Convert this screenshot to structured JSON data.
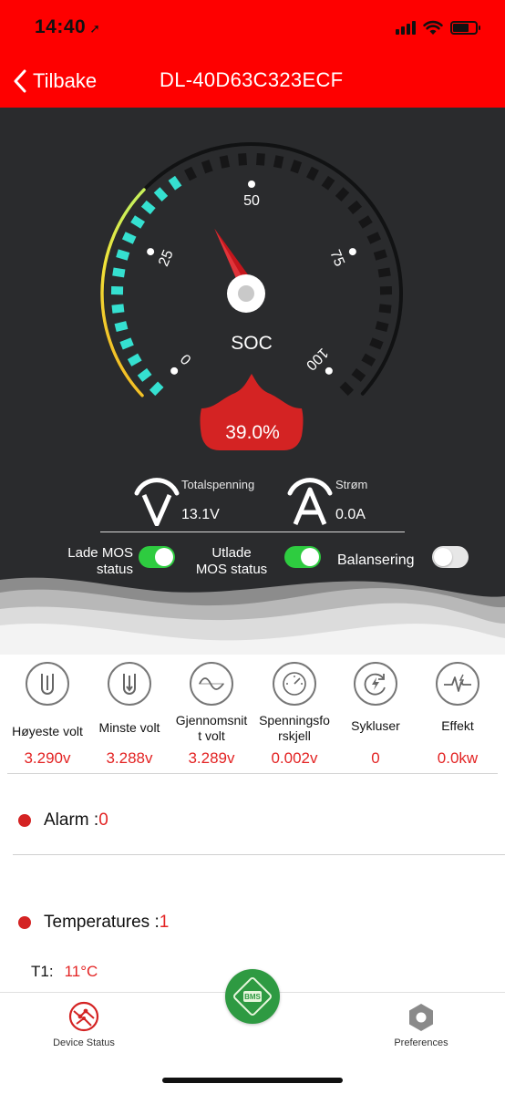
{
  "status_bar": {
    "time": "14:40",
    "location_glyph": "➚"
  },
  "header": {
    "back_label": "Tilbake",
    "title": "DL-40D63C323ECF",
    "color": "#fe0000"
  },
  "gauge": {
    "soc_label": "SOC",
    "soc_value": "39.0%",
    "soc_fraction": 0.39,
    "ticks": [
      "0",
      "25",
      "50",
      "75",
      "100"
    ],
    "active_color": "#35e0d0",
    "inactive_color": "#161617",
    "badge_color": "#d42323"
  },
  "metrics": {
    "voltage": {
      "icon": "voltage-icon",
      "label": "Totalspenning",
      "value": "13.1V"
    },
    "current": {
      "icon": "current-icon",
      "label": "Strøm",
      "value": "0.0A"
    }
  },
  "toggles": {
    "charge_mos": {
      "label_line1": "Lade MOS",
      "label_line2": "status",
      "state": "on"
    },
    "discharge_mos": {
      "label_line1": "Utlade",
      "label_line2": "MOS status",
      "state": "on"
    },
    "balancing": {
      "label": "Balansering",
      "state": "off"
    }
  },
  "stats": [
    {
      "icon": "highest-volt-icon",
      "label": "Høyeste volt",
      "value": "3.290v"
    },
    {
      "icon": "lowest-volt-icon",
      "label": "Minste volt",
      "value": "3.288v"
    },
    {
      "icon": "average-volt-icon",
      "label_line1": "Gjennomsnit",
      "label_line2": "t volt",
      "value": "3.289v"
    },
    {
      "icon": "voltage-diff-icon",
      "label_line1": "Spenningsfo",
      "label_line2": "rskjell",
      "value": "0.002v"
    },
    {
      "icon": "cycles-icon",
      "label": "Sykluser",
      "value": "0"
    },
    {
      "icon": "power-icon",
      "label": "Effekt",
      "value": "0.0kw"
    }
  ],
  "alarm": {
    "label": "Alarm :",
    "count": "0"
  },
  "temperatures": {
    "label": "Temperatures :",
    "count": "1",
    "items": [
      {
        "name": "T1:",
        "value": "11°C"
      }
    ]
  },
  "tabbar": {
    "device_status": "Device Status",
    "bms_label": "BMS",
    "preferences": "Preferences"
  }
}
